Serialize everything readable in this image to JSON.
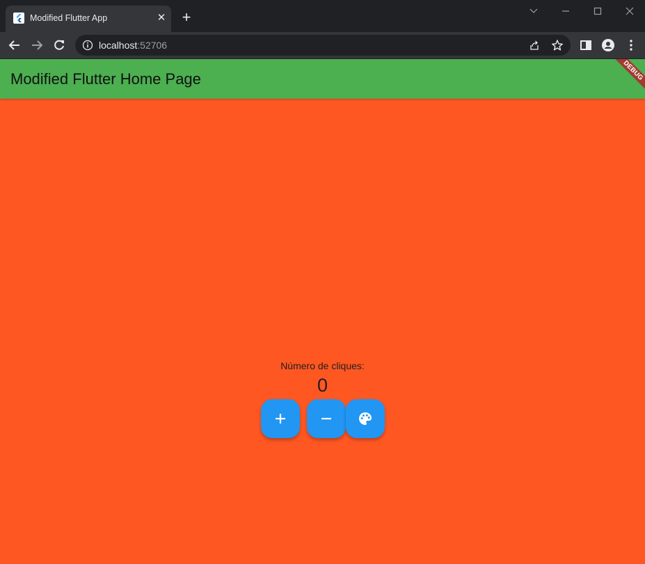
{
  "browser": {
    "tab": {
      "title": "Modified Flutter App",
      "favicon": "flutter-icon"
    },
    "address": {
      "host": "localhost",
      "port": ":52706"
    },
    "icons": [
      "back-icon",
      "forward-icon",
      "reload-icon",
      "info-icon",
      "share-icon",
      "star-icon",
      "side-panel-icon",
      "profile-icon",
      "menu-icon"
    ]
  },
  "app": {
    "appbar_title": "Modified Flutter Home Page",
    "debug_banner": "DEBUG",
    "counter_label": "Número de cliques:",
    "counter_value": "0",
    "buttons": {
      "increment_icon": "add-icon",
      "decrement_icon": "remove-icon",
      "color_icon": "palette-icon"
    },
    "colors": {
      "appbar": "#4caf50",
      "background": "#ff5722",
      "fab": "#2196f3"
    }
  }
}
